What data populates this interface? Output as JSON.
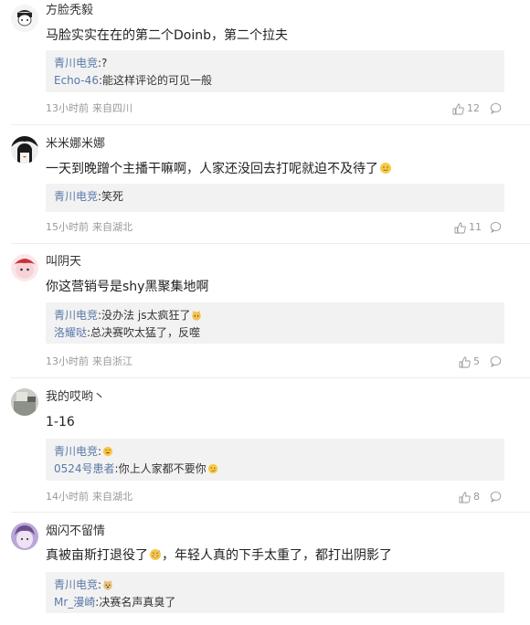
{
  "comments": [
    {
      "user": "方脸秃毅",
      "text": "马脸实实在在的第二个Doinb，第二个拉夫",
      "replies": [
        {
          "name": "青川电竞",
          "text": ":?"
        },
        {
          "name": "Echo-46",
          "text": ":能这样评论的可见一般"
        }
      ],
      "time": "13小时前",
      "location": "来自四川",
      "likes": "12"
    },
    {
      "user": "米米娜米娜",
      "text": "一天到晚蹭个主播干嘛啊，人家还没回去打呢就迫不及待了",
      "replies": [
        {
          "name": "青川电竞",
          "text": ":笑死"
        }
      ],
      "time": "15小时前",
      "location": "来自湖北",
      "likes": "11"
    },
    {
      "user": "叫阴天",
      "text": "你这营销号是shy黑聚集地啊",
      "replies": [
        {
          "name": "青川电竞",
          "text": ":没办法 js太疯狂了"
        },
        {
          "name": "洛耀哒",
          "text": ":总决赛吹太猛了，反噬"
        }
      ],
      "time": "13小时前",
      "location": "来自浙江",
      "likes": "5"
    },
    {
      "user": "我的哎哟丶",
      "text": "1-16",
      "replies": [
        {
          "name": "青川电竞",
          "text": ":"
        },
        {
          "name": "0524号患者",
          "text": ":你上人家都不要你"
        }
      ],
      "time": "14小时前",
      "location": "来自湖北",
      "likes": "8"
    },
    {
      "user": "烟闪不留情",
      "text": "真被亩斯打退役了",
      "text_after": "，年轻人真的下手太重了，都打出阴影了",
      "replies": [
        {
          "name": "青川电竞",
          "text": ":"
        },
        {
          "name": "Mr_漫崎",
          "text": ":决赛名声真臭了"
        }
      ]
    }
  ],
  "icons": {
    "like": "thumbs-up-icon",
    "reply": "comment-bubble-icon"
  },
  "colors": {
    "reply_name": "#5a79a8",
    "reply_bg": "#f2f2f2",
    "meta": "#999999"
  }
}
